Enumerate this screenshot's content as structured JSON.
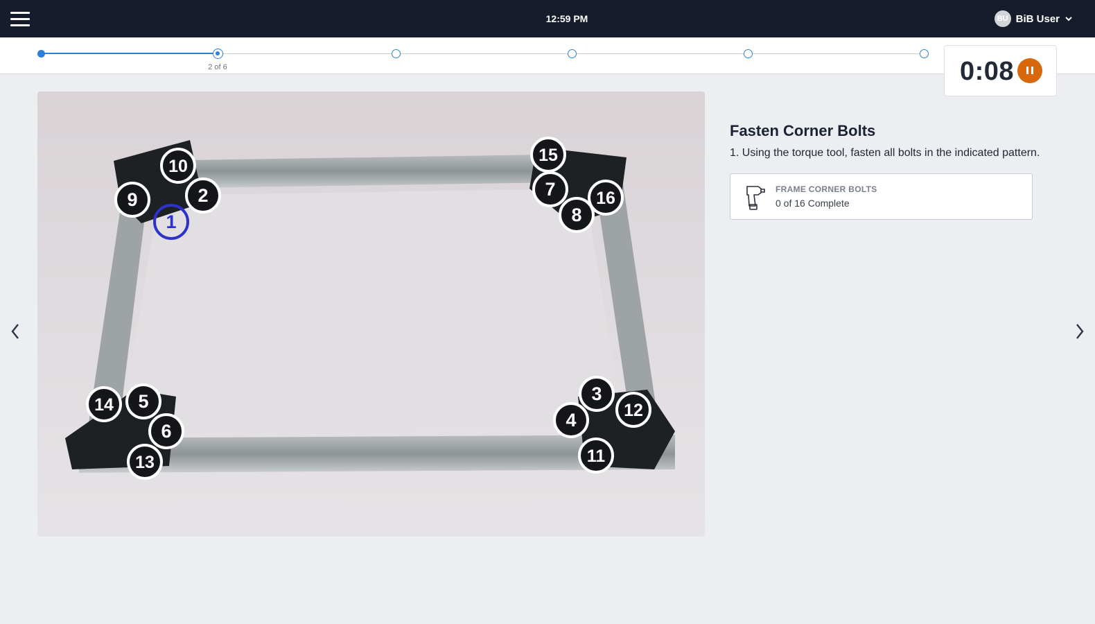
{
  "header": {
    "clock": "12:59 PM",
    "user": {
      "initials": "BU",
      "name": "BiB User"
    },
    "menu_icon": "hamburger-menu-icon"
  },
  "progress": {
    "current_step": 2,
    "total_steps": 6,
    "label": "2 of 6"
  },
  "timer": {
    "value": "0:08",
    "button_icon": "pause-icon",
    "button_color": "#d9680c"
  },
  "photo": {
    "bolt_labels": [
      "1",
      "2",
      "3",
      "4",
      "5",
      "6",
      "7",
      "8",
      "9",
      "10",
      "11",
      "12",
      "13",
      "14",
      "15",
      "16"
    ],
    "highlighted_bolt": "1",
    "highlight_color": "#2d32c8"
  },
  "instruction": {
    "title": "Fasten Corner Bolts",
    "text": "1. Using the torque tool, fasten all bolts in the indicated pattern."
  },
  "task": {
    "icon": "torque-drill-icon",
    "name": "FRAME CORNER BOLTS",
    "status": "0 of 16 Complete"
  },
  "nav": {
    "prev_icon": "chevron-left-icon",
    "next_icon": "chevron-right-icon"
  },
  "colors": {
    "topbar": "#161c2b",
    "accent": "#2f7fd8",
    "background": "#eceef1"
  }
}
